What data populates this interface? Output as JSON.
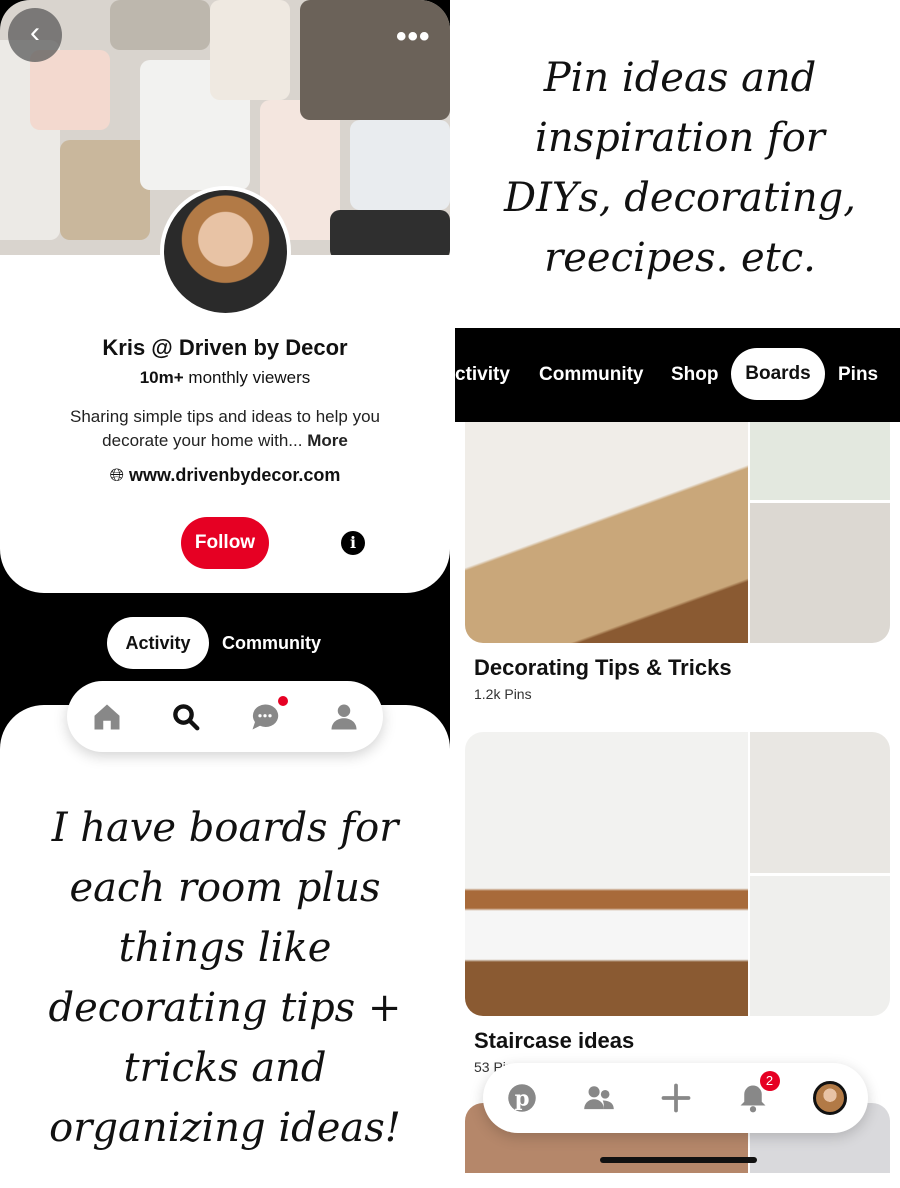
{
  "profile": {
    "name": "Kris @ Driven by Decor",
    "viewers_count": "10m+",
    "viewers_label": "monthly viewers",
    "bio_line1": "Sharing simple tips and ideas to help you",
    "bio_line2": "decorate your home with...",
    "more_label": "More",
    "website": "www.drivenbydecor.com",
    "follow_label": "Follow",
    "accent": "#e60023"
  },
  "left_tabs": [
    {
      "label": "Activity",
      "selected": true
    },
    {
      "label": "Community",
      "selected": false
    }
  ],
  "left_nav": {
    "icons": [
      "home-icon",
      "search-icon",
      "messages-icon",
      "profile-icon"
    ],
    "active": "search-icon",
    "messages_has_dot": true
  },
  "handwritten_right": [
    "Pin ideas and",
    "inspiration for",
    "DIYs, decorating,",
    "reecipes. etc."
  ],
  "handwritten_left": [
    "I have boards for",
    "each room plus",
    "things like",
    "decorating tips +",
    "tricks and",
    "organizing ideas!"
  ],
  "right_tabs": [
    {
      "label": "ctivity",
      "selected": false
    },
    {
      "label": "Community",
      "selected": false
    },
    {
      "label": "Shop",
      "selected": false
    },
    {
      "label": "Boards",
      "selected": true
    },
    {
      "label": "Pins",
      "selected": false
    }
  ],
  "boards": [
    {
      "title": "Decorating Tips & Tricks",
      "count": "1.2k Pins"
    },
    {
      "title": "Staircase ideas",
      "count": "53 Pins"
    }
  ],
  "bottom_nav": {
    "icons": [
      "pinterest-logo-icon",
      "following-icon",
      "create-icon",
      "notifications-icon",
      "profile-avatar"
    ],
    "notification_count": "2"
  }
}
